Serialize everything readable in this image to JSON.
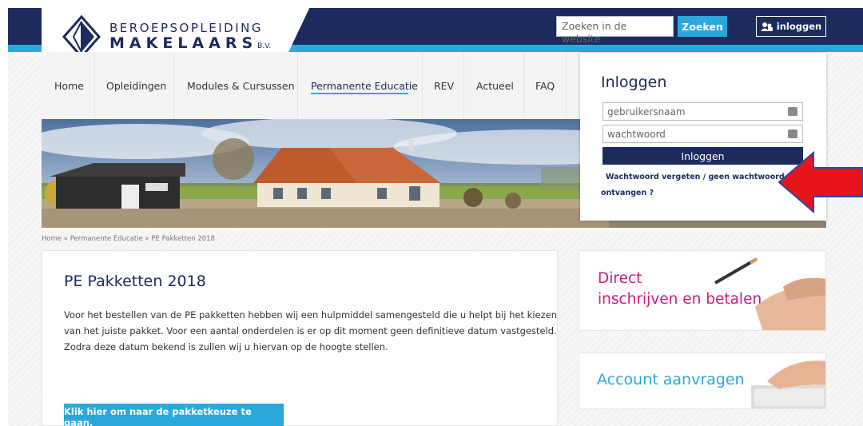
{
  "logo": {
    "line1": "BEROEPSOPLEIDING",
    "line2": "MAKELAARS",
    "suffix": "B.V."
  },
  "header": {
    "search_placeholder": "Zoeken in de website",
    "search_button": "Zoeken",
    "login_button": "inloggen"
  },
  "nav": {
    "items": [
      {
        "label": "Home"
      },
      {
        "label": "Opleidingen"
      },
      {
        "label": "Modules & Cursussen"
      },
      {
        "label": "Permanente Educatie"
      },
      {
        "label": "REV"
      },
      {
        "label": "Actueel"
      },
      {
        "label": "FAQ"
      }
    ],
    "active_index": 3
  },
  "breadcrumb": "Home » Permanente Educatie » PE Pakketten 2018",
  "content": {
    "title": "PE Pakketten 2018",
    "lines": [
      "Voor het bestellen van de PE pakketten hebben wij een hulpmiddel samengesteld die u helpt bij het kiezen",
      "van het juiste pakket. Voor een aantal onderdelen is er op dit moment geen definitieve datum vastgesteld.",
      "Zodra deze datum bekend is zullen wij u hiervan op de hoogte stellen."
    ],
    "cta": "Klik hier om naar de pakketkeuze te gaan."
  },
  "promos": {
    "direct_line1": "Direct",
    "direct_line2": "inschrijven en betalen",
    "account": "Account aanvragen"
  },
  "login_panel": {
    "title": "Inloggen",
    "username_placeholder": "gebruikersnaam",
    "password_placeholder": "wachtwoord",
    "submit": "Inloggen",
    "forgot_line1": "Wachtwoord vergeten / geen wachtwoord",
    "forgot_line2": "ontvangen ?"
  },
  "colors": {
    "navy": "#1c2a5e",
    "accent_blue": "#2aa8dc",
    "pink": "#d1197a",
    "arrow_red": "#e8141b"
  }
}
